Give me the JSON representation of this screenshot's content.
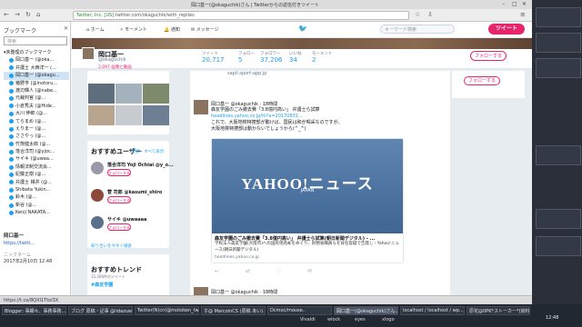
{
  "window": {
    "title": "岡口基一(@okaguchik)さん | Twitterからの返信付きツイート",
    "url_secure": "Twitter, Inc. [US]",
    "url": "twitter.com/okaguchik/with_replies"
  },
  "sidebar": {
    "title": "ブックマーク",
    "close": "✕",
    "search_placeholder": "検索",
    "items": [
      "未整理のブックマーク",
      "岡口基一 (@oka...",
      "弁護士 大西洋一 (...",
      "岡口基一 (@okagu...",
      "猪野亨 (@inotoru...",
      "渡辺輝人 (@nabe...",
      "元裁判官 (@...",
      "小倉秀夫 (@Hide...",
      "大川 伸郎 (@...",
      "てらまめ (@...",
      "えりまー (@...",
      "ささやっ (@...",
      "竹熊健太郎 (@...",
      "落合洋司 (@yjoc...",
      "サイキ (@uwaa...",
      "情報法制交流会...",
      "紀藤正樹 (@...",
      "弁護士 楊井 (@...",
      "Shibata Yukin...",
      "鈴木 (@...",
      "新谷 (@...",
      "Kenji NAKATA..."
    ],
    "selected_index": 3,
    "preview_title": "岡口基一",
    "preview_url": "https://twitt...",
    "preview_date_label": "ニックネーム",
    "preview_date": "2017年2月10日 12:48"
  },
  "twitter": {
    "nav": [
      "ホーム",
      "モーメント",
      "通知",
      "メッセージ"
    ],
    "search_placeholder": "キーワード検索",
    "tweet_button": "ツイート",
    "profile": {
      "name": "岡口基一",
      "handle": "@okaguchik",
      "link": "2,097 画像と動画",
      "stats": [
        {
          "label": "ツイート",
          "value": "20,717"
        },
        {
          "label": "フォロー",
          "value": "5"
        },
        {
          "label": "フォロワー",
          "value": "37,206"
        },
        {
          "label": "いいね",
          "value": "34"
        },
        {
          "label": "モーメント",
          "value": "2"
        }
      ],
      "follow": "フォローする"
    },
    "timeline_link": "sapil.sport-app.jp",
    "tweet": {
      "author": "岡口基一 @okaguchik · 18時間",
      "line1": "森友学園のごみ撤去費「3.8億円高い」 弁護士ら試算",
      "link": "headlines.yahoo.co.jp/hl?a=20170831...",
      "line2": "これで、大阪地検特捜部が動けば、国民は和が喝采なのですが。",
      "line3": "大阪地検特捜部は動かないでしょうから(^_^)"
    },
    "card": {
      "logo": "YAHOO!ニュース",
      "logo_sub": "JAPAN",
      "title": "森友学園のごみ撤去費「3.8億円高い」 弁護士ら試算(朝日新聞デジタル) - ...",
      "desc": "学校法人森友学園(大阪市)への国有地売却をめぐり、財務省職員らを背任容疑で告発し - Yahoo!ニュース(朝日新聞デジタル)",
      "domain": "headlines.yahoo.co.jp"
    },
    "actions": [
      "↩",
      "⇄",
      "♡",
      "✉"
    ],
    "tweet2_author": "岡口基一 @okaguchik · 18時間",
    "right_follow": "フォローする",
    "recommend": {
      "heading": "おすすめユーザー",
      "links": "更新 · すべて表示",
      "users": [
        {
          "name": "落合洋司 Yoji Ochiai @y_o..."
        },
        {
          "name": "菅 司郎 @kasumi_shiro"
        },
        {
          "name": "サイキ @uwaaaa"
        }
      ],
      "follow": "フォローする",
      "find": "知り合いを今すぐ検索"
    },
    "trends": {
      "heading": "おすすめトレンド",
      "sub": "15,300件のツイート",
      "item": "#森友学園"
    }
  },
  "statusbar": "https://t.co/8QXI1Ttol3X",
  "taskbar": {
    "tasks": [
      "Blogger: 事細々、事務事務...",
      "ブログ 原稿・記事 @iidazuwaa(2)",
      "Twitter(N)cn(@motoken_tw)",
      "ホ@ MarcoinCS (原稿 あい)...",
      "Dcmoc/mouse..",
      "岡口基一(@okaguchik)さん...",
      "localhost / localhost / wp...",
      "原花@0PK*ストーカー*(資料..."
    ],
    "active_index": 5,
    "row2": [
      "Vivaldi",
      "wlock",
      "eyes",
      "xlogo"
    ]
  },
  "clock": {
    "time": "12:48",
    "date": "2017年2月10日 金曜日"
  }
}
